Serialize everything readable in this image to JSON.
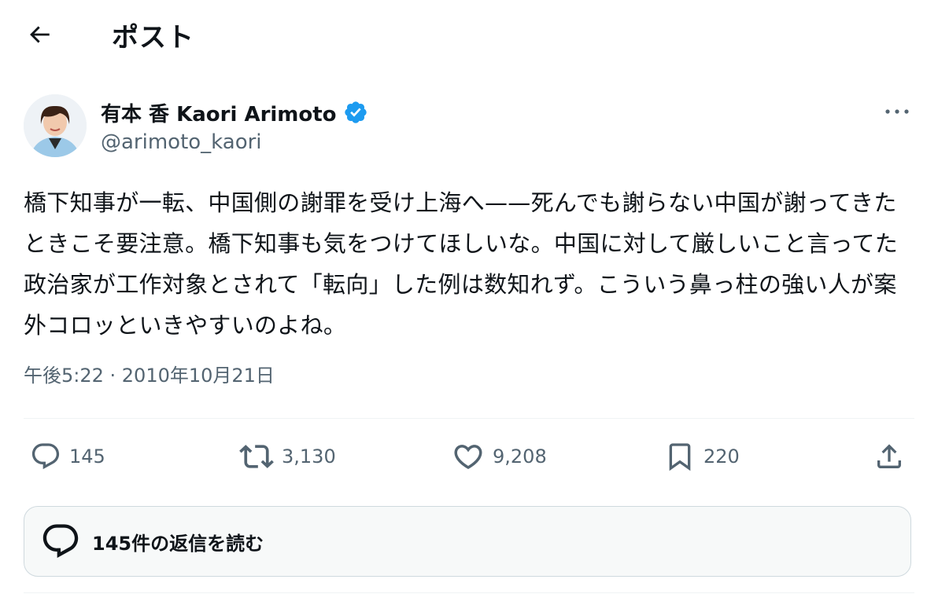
{
  "header": {
    "back_icon": "arrow-left-icon",
    "title": "ポスト"
  },
  "author": {
    "display_name": "有本 香 Kaori Arimoto",
    "handle": "@arimoto_kaori",
    "verified": true,
    "verified_color": "#1d9bf0",
    "avatar_icon": "profile-photo"
  },
  "tweet": {
    "text": "橋下知事が一転、中国側の謝罪を受け上海へ——死んでも謝らない中国が謝ってきたときこそ要注意。橋下知事も気をつけてほしいな。中国に対して厳しいこと言ってた政治家が工作対象とされて「転向」した例は数知れず。こういう鼻っ柱の強い人が案外コロッといきやすいのよね。",
    "timestamp": "午後5:22 · 2010年10月21日"
  },
  "actions": {
    "reply_count": "145",
    "retweet_count": "3,130",
    "like_count": "9,208",
    "bookmark_count": "220",
    "share_icon": "share-icon"
  },
  "replies_box": {
    "label": "145件の返信を読む"
  },
  "colors": {
    "text": "#0f1419",
    "secondary": "#536471",
    "divider": "#eff3f4",
    "accent": "#1d9bf0"
  }
}
